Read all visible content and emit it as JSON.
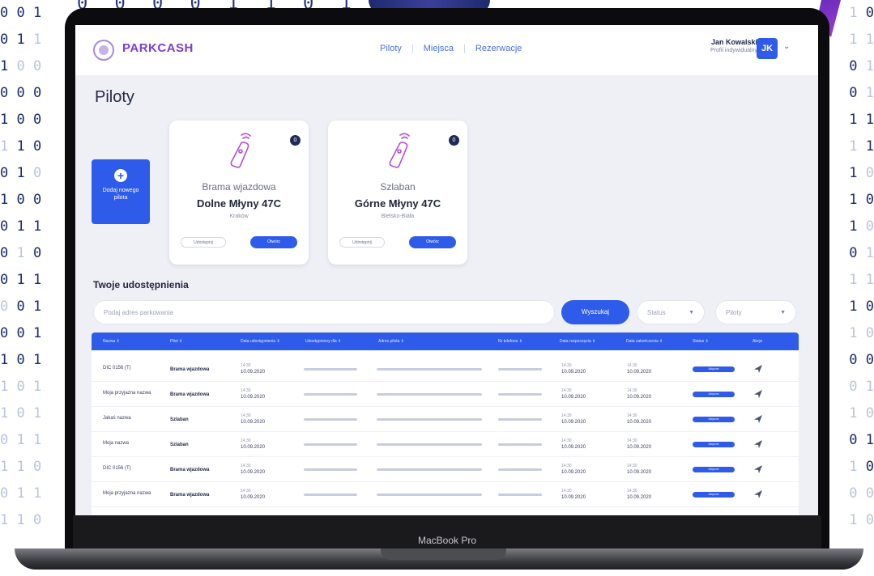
{
  "device_label": "MacBook Pro",
  "app": {
    "brand": "PARKCASH",
    "nav": [
      "Piloty",
      "Miejsca",
      "Rezerwacje"
    ],
    "user": {
      "name": "Jan Kowalski",
      "role": "Profil indywidualny",
      "initials": "JK"
    }
  },
  "page_title": "Piloty",
  "add_pilot_label": "Dodaj nowego pilota",
  "cards": [
    {
      "badge": "0",
      "type": "Brama wjazdowa",
      "name": "Dolne Młyny 47C",
      "city": "Kraków",
      "secondary_btn": "Udostępnij",
      "primary_btn": "Otwórz"
    },
    {
      "badge": "0",
      "type": "Szlaban",
      "name": "Górne Młyny 47C",
      "city": "Bielsko-Biała",
      "secondary_btn": "Udostępnij",
      "primary_btn": "Otwórz"
    }
  ],
  "shares_title": "Twoje udostępnienia",
  "search": {
    "placeholder": "Podaj adres parkowania",
    "button": "Wyszukaj",
    "status_select": "Status",
    "pilots_select": "Piloty"
  },
  "table": {
    "headers": [
      "Nazwa ⇕",
      "Pilot ⇕",
      "Data udostępnienia ⇕",
      "Udostępniony dla ⇕",
      "Adres pilota ⇕",
      "Nr telefonu ⇕",
      "Data rozpoczęcia ⇕",
      "Data zakończenia ⇕",
      "Status ⇕",
      "Akcje"
    ],
    "rows": [
      {
        "name": "DIC 0156 (T)",
        "pilot": "Brama wjazdowa",
        "share_time": "14:30",
        "share_date": "10.09.2020",
        "start_time": "14:30",
        "start_date": "10.09.2020",
        "end_time": "14:30",
        "end_date": "10.09.2020",
        "status": "Aktywne"
      },
      {
        "name": "Moja przyjazna nazwa",
        "pilot": "Brama wjazdowa",
        "share_time": "14:30",
        "share_date": "10.09.2020",
        "start_time": "14:30",
        "start_date": "10.09.2020",
        "end_time": "14:30",
        "end_date": "10.09.2020",
        "status": "Aktywne"
      },
      {
        "name": "Jakaś nazwa",
        "pilot": "Szlaban",
        "share_time": "14:30",
        "share_date": "10.09.2020",
        "start_time": "14:30",
        "start_date": "10.09.2020",
        "end_time": "14:30",
        "end_date": "10.09.2020",
        "status": "Aktywne"
      },
      {
        "name": "Moja nazwa",
        "pilot": "Szlaban",
        "share_time": "14:30",
        "share_date": "10.09.2020",
        "start_time": "14:30",
        "start_date": "10.09.2020",
        "end_time": "14:30",
        "end_date": "10.09.2020",
        "status": "Aktywne"
      },
      {
        "name": "DIC 0156 (T)",
        "pilot": "Brama wjazdowa",
        "share_time": "14:30",
        "share_date": "10.09.2020",
        "start_time": "14:30",
        "start_date": "10.09.2020",
        "end_time": "14:30",
        "end_date": "10.09.2020",
        "status": "Aktywne"
      },
      {
        "name": "Moja przyjazna nazwa",
        "pilot": "Brama wjazdowa",
        "share_time": "14:30",
        "share_date": "10.09.2020",
        "start_time": "14:30",
        "start_date": "10.09.2020",
        "end_time": "14:30",
        "end_date": "10.09.2020",
        "status": "Aktywne"
      }
    ]
  },
  "colors": {
    "accent": "#2f5bea",
    "brand": "#7b3fd1",
    "pilot_icon": "#b24fd8"
  },
  "icons": {
    "pilot": "remote-control-icon",
    "add": "plus-circle-icon",
    "action": "send-icon"
  }
}
